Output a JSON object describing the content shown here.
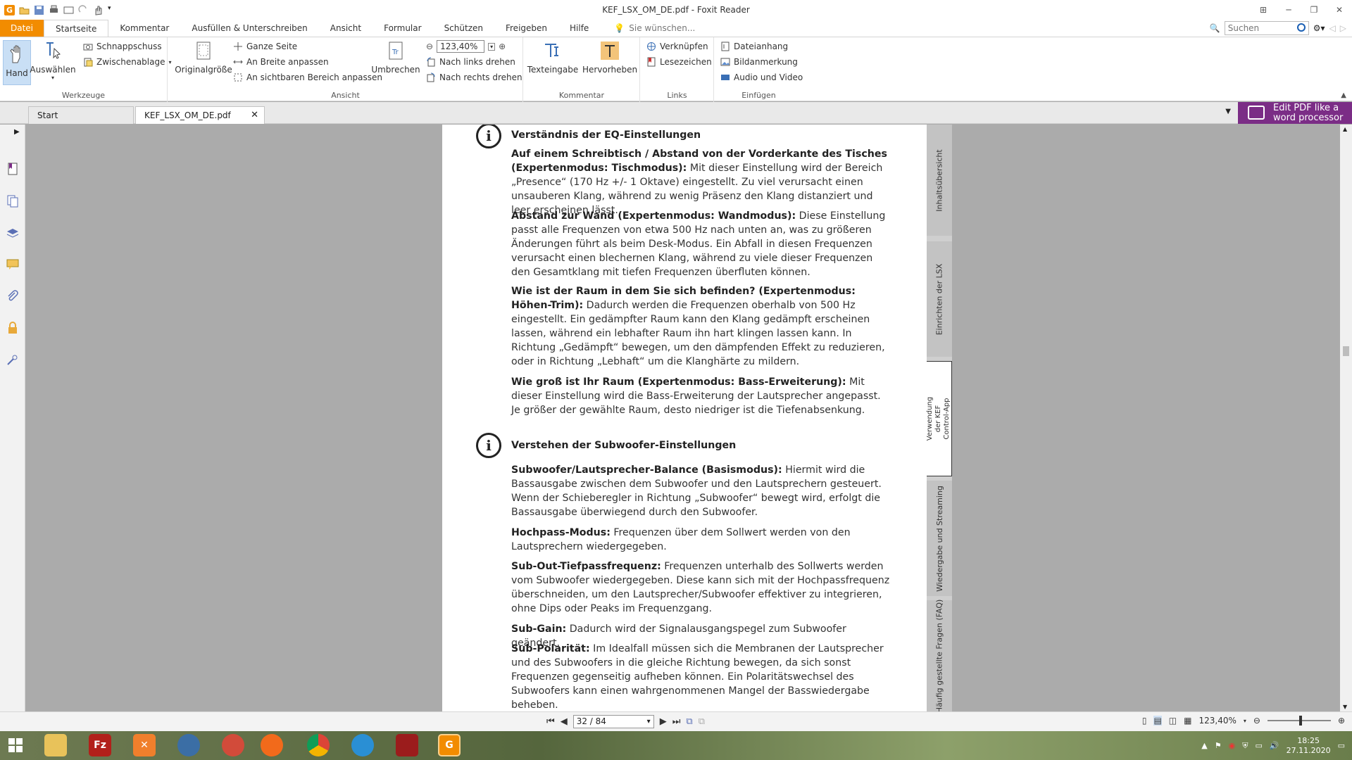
{
  "window": {
    "title": "KEF_LSX_OM_DE.pdf - Foxit Reader"
  },
  "menu": {
    "file": "Datei",
    "tabs": [
      "Startseite",
      "Kommentar",
      "Ausfüllen & Unterschreiben",
      "Ansicht",
      "Formular",
      "Schützen",
      "Freigeben",
      "Hilfe"
    ],
    "tell_me": "Sie wünschen...",
    "search_placeholder": "Suchen"
  },
  "ribbon": {
    "werkzeuge": {
      "label": "Werkzeuge",
      "hand": "Hand",
      "auswaehlen": "Auswählen",
      "schnappschuss": "Schnappschuss",
      "zwischenablage": "Zwischenablage"
    },
    "ansicht": {
      "label": "Ansicht",
      "originalgroesse": "Originalgröße",
      "ganze_seite": "Ganze Seite",
      "an_breite": "An Breite anpassen",
      "sichtbar": "An sichtbaren Bereich anpassen",
      "umbrechen": "Umbrechen",
      "zoom": "123,40%",
      "links_drehen": "Nach links drehen",
      "rechts_drehen": "Nach rechts drehen"
    },
    "kommentar": {
      "label": "Kommentar",
      "texteingabe": "Texteingabe",
      "hervorheben": "Hervorheben"
    },
    "links": {
      "label": "Links",
      "verknuepfen": "Verknüpfen",
      "lesezeichen": "Lesezeichen"
    },
    "einfuegen": {
      "label": "Einfügen",
      "dateianhang": "Dateianhang",
      "bildanmerkung": "Bildanmerkung",
      "audio_video": "Audio und Video"
    }
  },
  "doctabs": {
    "start": "Start",
    "file": "KEF_LSX_OM_DE.pdf",
    "promo": "Edit PDF like a word processor"
  },
  "page": {
    "section1": {
      "heading": "Verständnis der EQ-Einstellungen",
      "paras": [
        {
          "bold": "Auf einem Schreibtisch / Abstand von der Vorderkante des Tisches (Expertenmodus: Tischmodus):",
          "text": " Mit dieser Einstellung wird der Bereich „Presence“ (170 Hz +/- 1 Oktave) eingestellt. Zu viel verursacht einen unsauberen Klang, während zu wenig Präsenz den Klang distanziert und leer erscheinen lässt."
        },
        {
          "bold": "Abstand zur Wand (Expertenmodus: Wandmodus):",
          "text": " Diese Einstellung passt alle Frequenzen von etwa 500 Hz nach unten an, was zu größeren Änderungen führt als beim Desk-Modus. Ein Abfall in diesen Frequenzen verursacht einen blechernen Klang, während zu viele dieser Frequenzen den Gesamtklang mit tiefen Frequenzen überfluten können."
        },
        {
          "bold": "Wie ist der Raum in dem Sie sich befinden? (Expertenmodus: Höhen-Trim):",
          "text": " Dadurch werden die Frequenzen oberhalb von 500 Hz eingestellt. Ein gedämpfter Raum kann den Klang gedämpft erscheinen lassen, während ein lebhafter Raum ihn hart klingen lassen kann. In Richtung „Gedämpft“ bewegen, um den dämpfenden Effekt zu reduzieren, oder in Richtung „Lebhaft“ um die Klanghärte zu mildern."
        },
        {
          "bold": "Wie groß ist Ihr Raum (Expertenmodus: Bass-Erweiterung):",
          "text": " Mit dieser Einstellung wird die Bass-Erweiterung der Lautsprecher angepasst. Je größer der gewählte Raum, desto niedriger ist die Tiefenabsenkung."
        }
      ]
    },
    "section2": {
      "heading": "Verstehen der Subwoofer-Einstellungen",
      "paras": [
        {
          "bold": "Subwoofer/Lautsprecher-Balance (Basismodus):",
          "text": " Hiermit wird die Bassausgabe zwischen dem Subwoofer und den Lautsprechern gesteuert. Wenn der Schieberegler in Richtung „Subwoofer“ bewegt wird, erfolgt die Bassausgabe überwiegend durch den Subwoofer."
        },
        {
          "bold": "Hochpass-Modus:",
          "text": " Frequenzen über dem Sollwert werden von den Lautsprechern wiedergegeben."
        },
        {
          "bold": "Sub-Out-Tiefpassfrequenz:",
          "text": " Frequenzen unterhalb des Sollwerts werden vom Subwoofer wiedergegeben. Diese kann sich mit der Hochpassfrequenz überschneiden, um den Lautsprecher/Subwoofer effektiver zu integrieren, ohne Dips oder Peaks im Frequenzgang."
        },
        {
          "bold": "Sub-Gain:",
          "text": " Dadurch wird der Signalausgangspegel zum Subwoofer geändert."
        },
        {
          "bold": "Sub-Polarität:",
          "text": " Im Idealfall müssen sich die Membranen der Lautsprecher und des Subwoofers in die gleiche Richtung bewegen, da sich sonst Frequenzen gegenseitig aufheben können. Ein Polaritätswechsel des Subwoofers kann einen wahrgenommenen Mangel der Basswiedergabe beheben."
        }
      ]
    },
    "side_tabs": [
      "Inhaltsübersicht",
      "Einrichten der LSX",
      "Verwendung der KEF Control-App",
      "Wiedergabe und Streaming",
      "Häufig gestellte Fragen (FAQ)"
    ]
  },
  "status": {
    "page": "32 / 84",
    "zoom": "123,40%"
  },
  "taskbar": {
    "time": "18:25",
    "date": "27.11.2020"
  },
  "colors": {
    "accent": "#f28c00",
    "promo": "#7b2d86"
  }
}
